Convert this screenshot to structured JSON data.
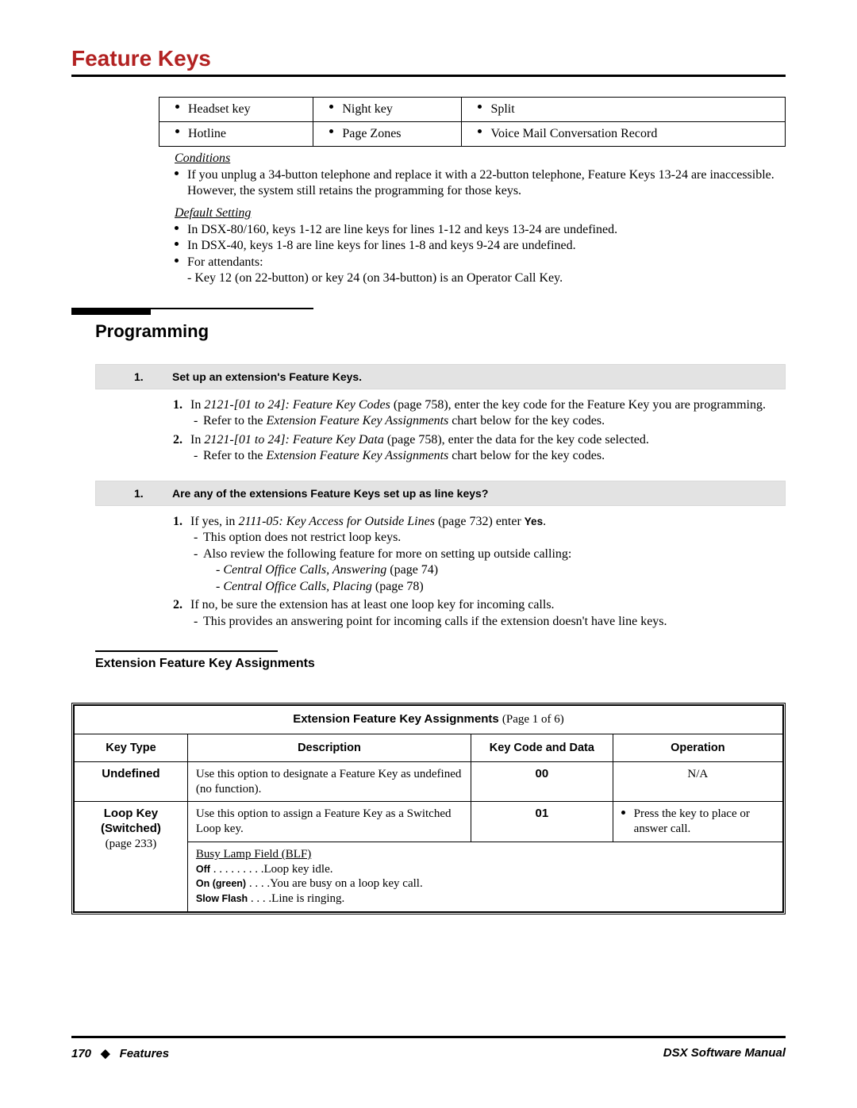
{
  "page_title": "Feature Keys",
  "top_table": {
    "rows": [
      [
        "Headset key",
        "Night key",
        "Split"
      ],
      [
        "Hotline",
        "Page Zones",
        "Voice Mail Conversation Record"
      ]
    ]
  },
  "conditions_heading": "Conditions",
  "conditions": [
    "If you unplug a 34-button telephone and replace it with a 22-button telephone, Feature Keys 13-24 are inaccessible. However, the system still retains the programming for those keys."
  ],
  "default_heading": "Default Setting",
  "defaults": [
    {
      "text": "In DSX-80/160, keys 1-12 are line keys for lines 1-12 and keys 13-24 are undefined."
    },
    {
      "text": "In DSX-40, keys 1-8 are line keys for lines 1-8 and keys 9-24 are undefined."
    },
    {
      "text": "For attendants:",
      "sub": "- Key 12 (on 22-button) or key 24 (on 34-button) is an Operator Call Key."
    }
  ],
  "section_heading": "Programming",
  "step1": {
    "num": "1.",
    "title": "Set up an extension's Feature Keys.",
    "items": [
      {
        "no": "1.",
        "pre": "In ",
        "it": "2121-[01 to 24]: Feature Key Codes",
        "post": " (page 758), enter the key code for the Feature Key you are programming.",
        "dash": [
          {
            "pre": "Refer to the ",
            "it": "Extension Feature Key Assignments",
            "post": " chart below for the key codes."
          }
        ]
      },
      {
        "no": "2.",
        "pre": "In ",
        "it": "2121-[01 to 24]: Feature Key Data",
        "post": " (page 758), enter the data for the key code selected.",
        "dash": [
          {
            "pre": "Refer to the ",
            "it": "Extension Feature Key Assignments",
            "post": " chart below for the key codes."
          }
        ]
      }
    ]
  },
  "step2": {
    "num": "1.",
    "title": "Are any of the extensions Feature Keys set up as line keys?",
    "items": [
      {
        "no": "1.",
        "pre": "If yes, in ",
        "it": "2111-05: Key Access for Outside Lines",
        "post": " (page 732) enter ",
        "boldword": "Yes",
        "post2": ".",
        "dash": [
          {
            "plain": "This option does not restrict loop keys."
          },
          {
            "plain": "Also review the following feature for more on setting up outside calling:"
          }
        ],
        "subdash": [
          {
            "it": "- Central Office Calls, Answering",
            "post": " (page 74)"
          },
          {
            "it": "- Central Office Calls, Placing",
            "post": " (page 78)"
          }
        ]
      },
      {
        "no": "2.",
        "plain": "If no, be sure the extension has at least one loop key for incoming calls.",
        "dash": [
          {
            "plain": "This provides an answering point for incoming calls if the extension doesn't have line keys."
          }
        ]
      }
    ]
  },
  "chart_title": "Extension Feature Key Assignments",
  "assign_table": {
    "title_prefix": "Extension Feature Key Assignments  ",
    "title_suffix": "(Page 1 of 6)",
    "headers": [
      "Key Type",
      "Description",
      "Key Code and Data",
      "Operation"
    ],
    "rows": [
      {
        "keytype_bold": "Undefined",
        "keytype_rest": "",
        "desc": "Use this option to designate a Feature Key as undefined (no function).",
        "code": "00",
        "op_plain": "N/A"
      },
      {
        "keytype_bold": "Loop Key (Switched)",
        "keytype_rest": "(page 233)",
        "desc": "Use this option to assign a Feature Key as a Switched Loop key.",
        "code": "01",
        "op_bullet": "Press the key to place or answer call."
      }
    ],
    "blf": {
      "title": "Busy Lamp Field (BLF)",
      "lines": [
        {
          "code": "Off",
          "dots": " . . . . . . . . .",
          "text": "Loop key idle."
        },
        {
          "code": "On (green)",
          "dots": " . . . .",
          "text": "You are busy on a loop key call."
        },
        {
          "code": "Slow Flash",
          "dots": " . . . .",
          "text": "Line is ringing."
        }
      ]
    }
  },
  "footer": {
    "page_num": "170",
    "diamond": "◆",
    "left_label": "Features",
    "right_label": "DSX Software Manual"
  }
}
